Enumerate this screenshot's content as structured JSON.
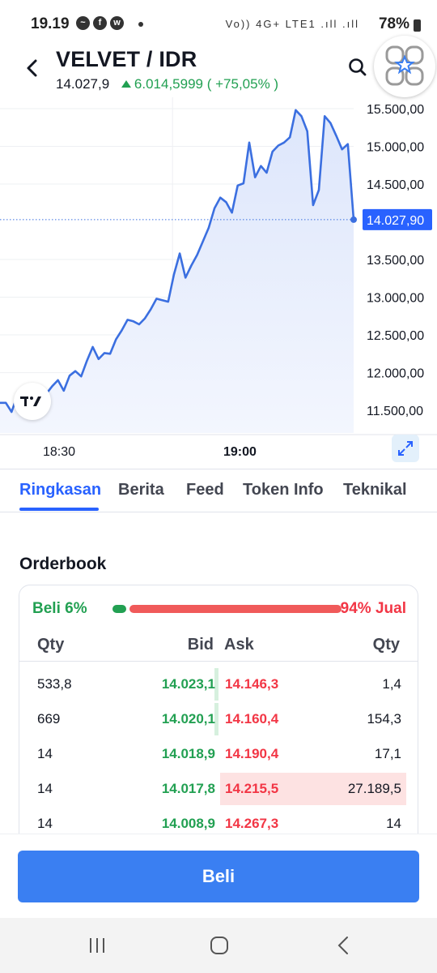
{
  "status_bar": {
    "time": "19.19",
    "battery": "78%",
    "network": "Vo)) 4G+ LTE1 .ıll .ıll",
    "notification_icons": [
      "messenger-icon",
      "facebook-icon",
      "whatsapp-icon"
    ]
  },
  "header": {
    "pair": "VELVET / IDR",
    "last_price": "14.027,9",
    "change": "6.014,5999 ( +75,05% )",
    "change_direction": "up"
  },
  "chart": {
    "x_ticks": [
      "18:30",
      "19:00"
    ],
    "y_ticks": [
      "15.500,00",
      "15.000,00",
      "14.500,00",
      "13.500,00",
      "13.000,00",
      "12.500,00",
      "12.000,00",
      "11.500,00"
    ],
    "current_label": "14.027,90"
  },
  "chart_data": {
    "type": "area",
    "x_ticks": [
      "18:30",
      "19:00"
    ],
    "ylim": [
      11200,
      15650
    ],
    "series": [
      {
        "values": [
          11600,
          11600,
          11480,
          11700,
          11760,
          11740,
          11780,
          11640,
          11720,
          11820,
          11900,
          11760,
          11960,
          12020,
          11950,
          12160,
          12340,
          12180,
          12260,
          12250,
          12440,
          12560,
          12700,
          12680,
          12640,
          12720,
          12840,
          12980,
          12960,
          12940,
          13300,
          13580,
          13260,
          13420,
          13560,
          13740,
          13920,
          14180,
          14320,
          14260,
          14120,
          14480,
          14510,
          15050,
          14590,
          14740,
          14650,
          14930,
          15010,
          15050,
          15120,
          15480,
          15400,
          15200,
          14220,
          14420,
          15400,
          15310,
          15140,
          14960,
          15030,
          14030
        ]
      }
    ],
    "current_value": 14027.9,
    "grid": true,
    "colors": {
      "line": "#3b6fe0",
      "fill_top": "#dde6fb",
      "fill_bottom": "#f3f6fe",
      "label_bg": "#2962ff"
    }
  },
  "tabs": [
    {
      "label": "Ringkasan",
      "active": true
    },
    {
      "label": "Berita",
      "active": false
    },
    {
      "label": "Feed",
      "active": false
    },
    {
      "label": "Token Info",
      "active": false
    },
    {
      "label": "Teknikal",
      "active": false
    }
  ],
  "orderbook": {
    "title": "Orderbook",
    "buy_label": "Beli 6%",
    "sell_label": "94% Jual",
    "buy_ratio": 0.06,
    "sell_ratio": 0.94,
    "headers": {
      "qty_left": "Qty",
      "bid": "Bid",
      "ask": "Ask",
      "qty_right": "Qty"
    },
    "rows": [
      {
        "bid_qty": "533,8",
        "bid": "14.023,1",
        "ask": "14.146,3",
        "ask_qty": "1,4",
        "bid_depth": 0.02,
        "ask_depth": 0.0
      },
      {
        "bid_qty": "669",
        "bid": "14.020,1",
        "ask": "14.160,4",
        "ask_qty": "154,3",
        "bid_depth": 0.02,
        "ask_depth": 0.0
      },
      {
        "bid_qty": "14",
        "bid": "14.018,9",
        "ask": "14.190,4",
        "ask_qty": "17,1",
        "bid_depth": 0.0,
        "ask_depth": 0.0
      },
      {
        "bid_qty": "14",
        "bid": "14.017,8",
        "ask": "14.215,5",
        "ask_qty": "27.189,5",
        "bid_depth": 0.0,
        "ask_depth": 1.0
      },
      {
        "bid_qty": "14",
        "bid": "14.008,9",
        "ask": "14.267,3",
        "ask_qty": "14",
        "bid_depth": 0.0,
        "ask_depth": 0.0
      }
    ]
  },
  "actions": {
    "buy_button": "Beli"
  },
  "nav": [
    "recent-apps-icon",
    "home-icon",
    "back-icon"
  ],
  "colors": {
    "accent": "#2962ff",
    "up": "#22a052",
    "down": "#f23645",
    "buy_button": "#3a7ff2"
  }
}
